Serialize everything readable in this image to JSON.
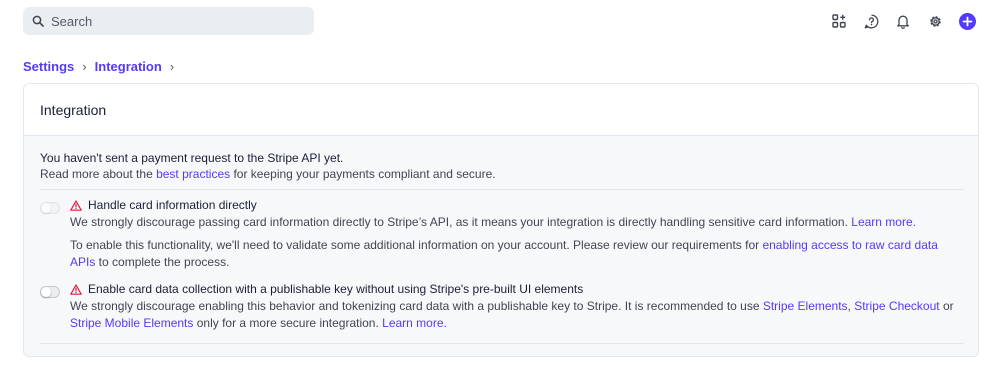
{
  "search": {
    "placeholder": "Search"
  },
  "toolbar": {
    "icons": [
      "apps-icon",
      "help-icon",
      "notifications-icon",
      "settings-icon",
      "create-icon"
    ],
    "accent": "#533afd"
  },
  "breadcrumb": {
    "items": [
      "Settings",
      "Integration"
    ],
    "separator": "›"
  },
  "card": {
    "title": "Integration",
    "intro_line1": "You haven't sent a payment request to the Stripe API yet.",
    "intro_line2_prefix": "Read more about the ",
    "intro_line2_link": "best practices",
    "intro_line2_suffix": " for keeping your payments compliant and secure.",
    "options": [
      {
        "title": "Handle card information directly",
        "enabled": false,
        "disabled": true,
        "desc_prefix": "We strongly discourage passing card information directly to Stripe’s API, as it means your integration is directly handling sensitive card information. ",
        "desc_link": "Learn more.",
        "note_prefix": "To enable this functionality, we'll need to validate some additional information on your account. Please review our requirements for ",
        "note_link": "enabling access to raw card data APIs",
        "note_suffix": " to complete the process."
      },
      {
        "title": "Enable card data collection with a publishable key without using Stripe's pre-built UI elements",
        "enabled": false,
        "disabled": false,
        "desc_prefix": "We strongly discourage enabling this behavior and tokenizing card data with a publishable key to Stripe. It is recommended to use ",
        "link_elements": "Stripe Elements",
        "sep1": ", ",
        "link_checkout": "Stripe Checkout",
        "sep2": " or ",
        "link_mobile": "Stripe Mobile Elements",
        "mid": " only for a more secure integration. ",
        "desc_link": "Learn more."
      }
    ]
  }
}
